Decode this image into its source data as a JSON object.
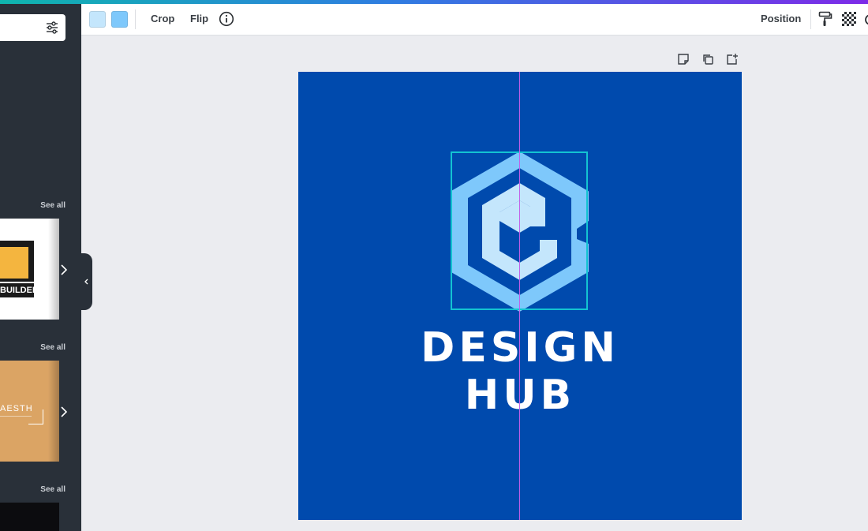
{
  "toolbar": {
    "swatches": [
      "#c4e6fc",
      "#7ec8fb"
    ],
    "crop_label": "Crop",
    "flip_label": "Flip",
    "position_label": "Position"
  },
  "left_panel": {
    "sections": [
      {
        "see_all": "See all",
        "thumb_text": "BUILDERS"
      },
      {
        "see_all": "See all",
        "thumb_text": "AESTHETIC"
      },
      {
        "see_all": "See all",
        "thumb_text": ""
      }
    ]
  },
  "canvas": {
    "background_color": "#004aad",
    "logo_colors": {
      "outer": "#7ec8fb",
      "inner": "#c4e6fc"
    },
    "text_line1": "DESIGN",
    "text_line2": "HUB"
  },
  "icons": {
    "filter": "sliders-icon",
    "info": "info-icon",
    "paint": "paint-roller-icon",
    "transparency": "checkerboard-icon",
    "page_note": "sticky-note-icon",
    "duplicate": "duplicate-page-icon",
    "add_page": "add-page-icon"
  }
}
